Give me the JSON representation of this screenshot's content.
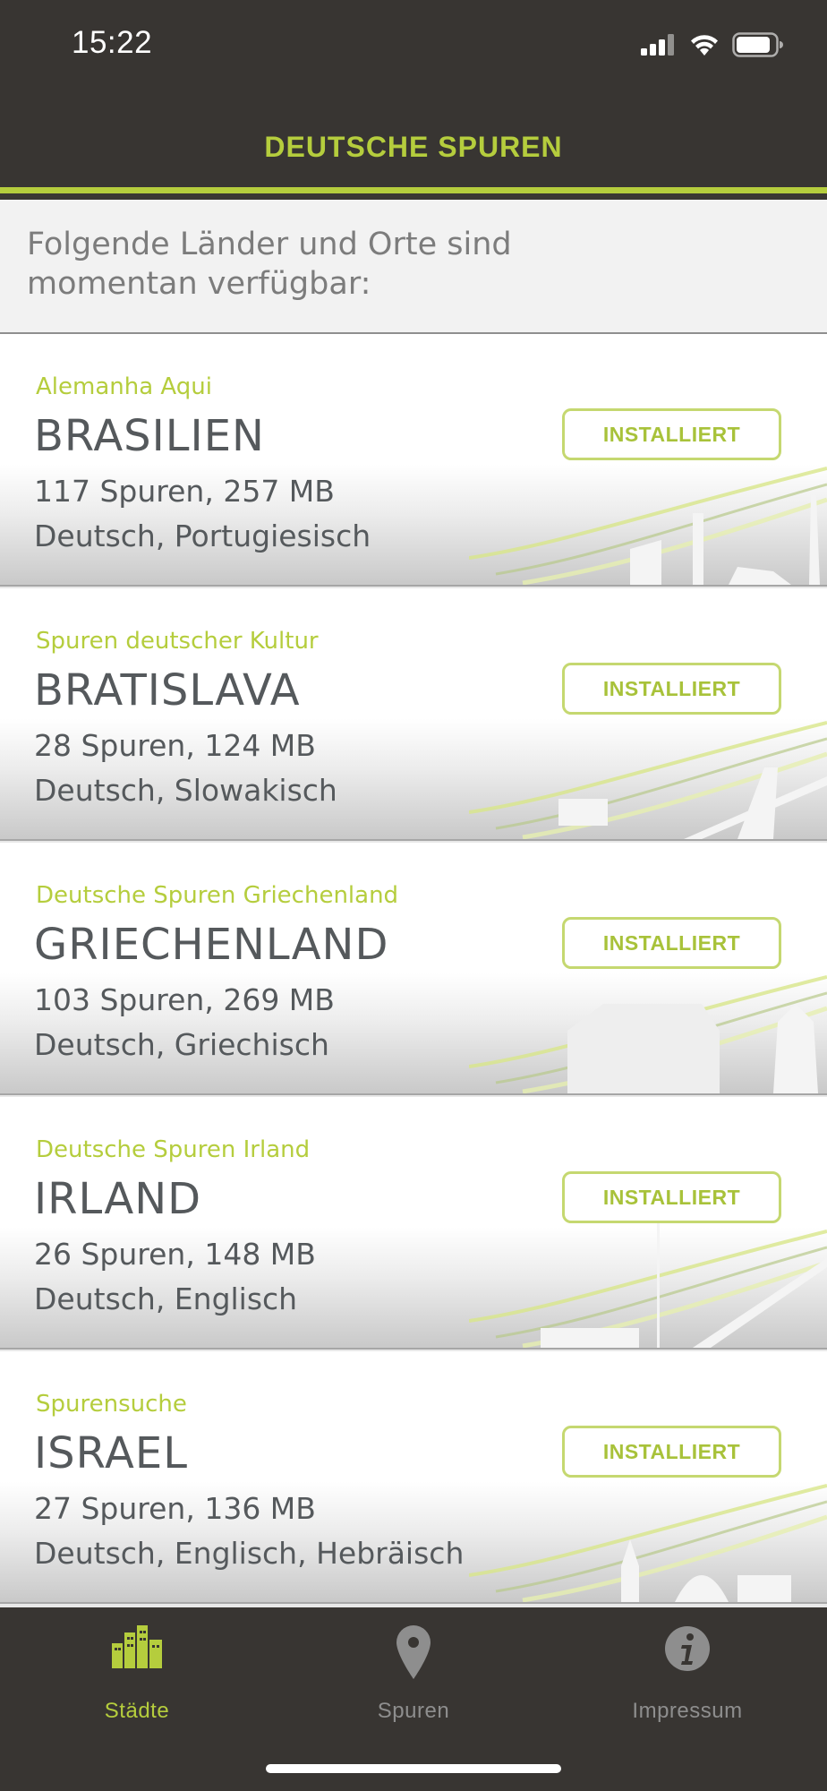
{
  "status": {
    "time": "15:22"
  },
  "header": {
    "title": "DEUTSCHE SPUREN"
  },
  "intro": {
    "text": "Folgende Länder und Orte sind momentan verfügbar:"
  },
  "cards": [
    {
      "subtitle": "Alemanha Aqui",
      "title": "BRASILIEN",
      "info": "117 Spuren, 257 MB",
      "languages": "Deutsch, Portugiesisch",
      "button": "INSTALLIERT"
    },
    {
      "subtitle": "Spuren deutscher Kultur",
      "title": "BRATISLAVA",
      "info": "28 Spuren, 124 MB",
      "languages": "Deutsch, Slowakisch",
      "button": "INSTALLIERT"
    },
    {
      "subtitle": "Deutsche Spuren Griechenland",
      "title": "GRIECHENLAND",
      "info": "103 Spuren, 269 MB",
      "languages": "Deutsch, Griechisch",
      "button": "INSTALLIERT"
    },
    {
      "subtitle": "Deutsche Spuren Irland",
      "title": "IRLAND",
      "info": "26 Spuren, 148 MB",
      "languages": "Deutsch, Englisch",
      "button": "INSTALLIERT"
    },
    {
      "subtitle": "Spurensuche",
      "title": "ISRAEL",
      "info": "27 Spuren, 136 MB",
      "languages": "Deutsch, Englisch, Hebräisch",
      "button": "INSTALLIERT"
    }
  ],
  "tabs": [
    {
      "label": "Städte",
      "icon": "city-icon",
      "active": true
    },
    {
      "label": "Spuren",
      "icon": "map-pin-icon",
      "active": false
    },
    {
      "label": "Impressum",
      "icon": "info-icon",
      "active": false
    }
  ],
  "colors": {
    "accent": "#b5cd3d",
    "bar": "#383532",
    "text": "#55595c"
  }
}
